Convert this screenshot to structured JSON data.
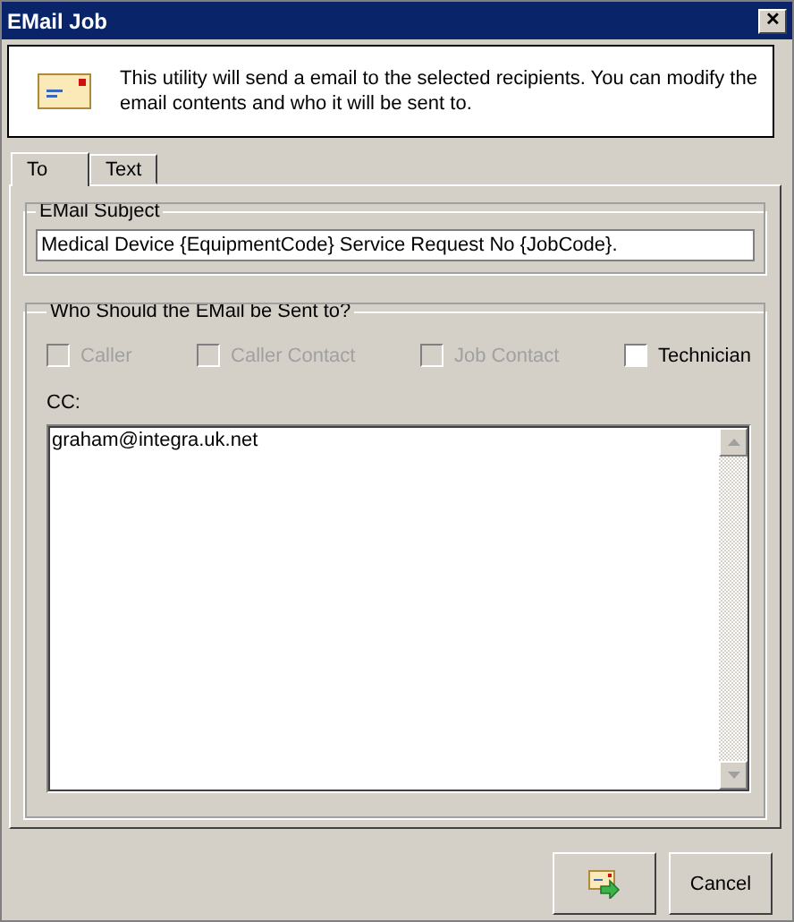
{
  "window": {
    "title": "EMail Job",
    "close": "✕"
  },
  "header": {
    "text": "This utility will send a email to the selected recipients. You can modify the email contents and who it will be sent to."
  },
  "tabs": [
    {
      "label": "To",
      "selected": true
    },
    {
      "label": "Text",
      "selected": false
    }
  ],
  "subject": {
    "legend": "EMail Subject",
    "value": "Medical Device {EquipmentCode} Service Request No {JobCode}."
  },
  "recipients": {
    "legend": "Who Should the EMail be Sent to?",
    "options": [
      {
        "label": "Caller",
        "checked": false,
        "disabled": true
      },
      {
        "label": "Caller Contact",
        "checked": false,
        "disabled": true
      },
      {
        "label": "Job Contact",
        "checked": false,
        "disabled": true
      },
      {
        "label": "Technician",
        "checked": false,
        "disabled": false
      }
    ],
    "cc_label": "CC:",
    "cc_value": "graham@integra.uk.net"
  },
  "buttons": [
    {
      "kind": "send"
    },
    {
      "kind": "text",
      "label": "Cancel"
    }
  ]
}
